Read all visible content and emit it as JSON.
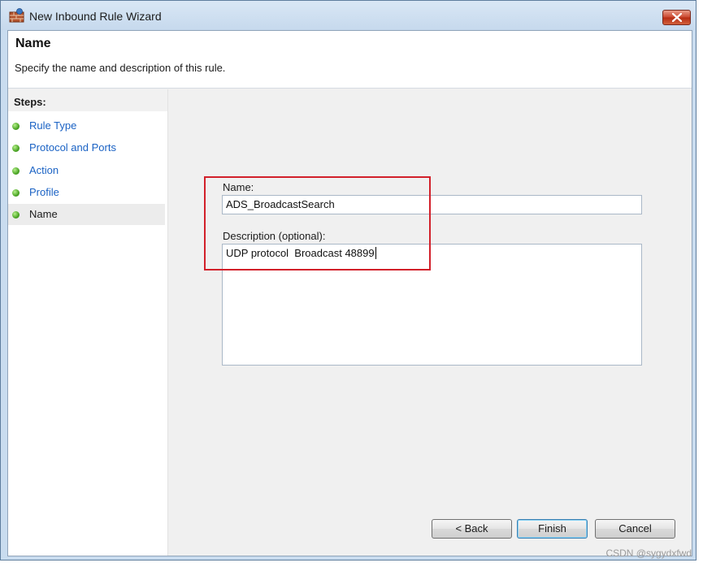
{
  "window": {
    "title": "New Inbound Rule Wizard",
    "icon": "firewall-wall-icon",
    "close_icon": "close-x-icon"
  },
  "header": {
    "title": "Name",
    "description": "Specify the name and description of this rule."
  },
  "steps": {
    "heading": "Steps:",
    "items": [
      {
        "label": "Rule Type",
        "current": false
      },
      {
        "label": "Protocol and Ports",
        "current": false
      },
      {
        "label": "Action",
        "current": false
      },
      {
        "label": "Profile",
        "current": false
      },
      {
        "label": "Name",
        "current": true
      }
    ]
  },
  "form": {
    "name_label": "Name:",
    "name_value": "ADS_BroadcastSearch",
    "description_label": "Description (optional):",
    "description_value": "UDP protocol  Broadcast 48899"
  },
  "buttons": {
    "back": "< Back",
    "finish": "Finish",
    "cancel": "Cancel"
  },
  "watermark": "CSDN @sygydxfwd",
  "colors": {
    "link": "#1a62c4",
    "highlight_box": "#d2202a",
    "step_dot": "#4ba525"
  }
}
